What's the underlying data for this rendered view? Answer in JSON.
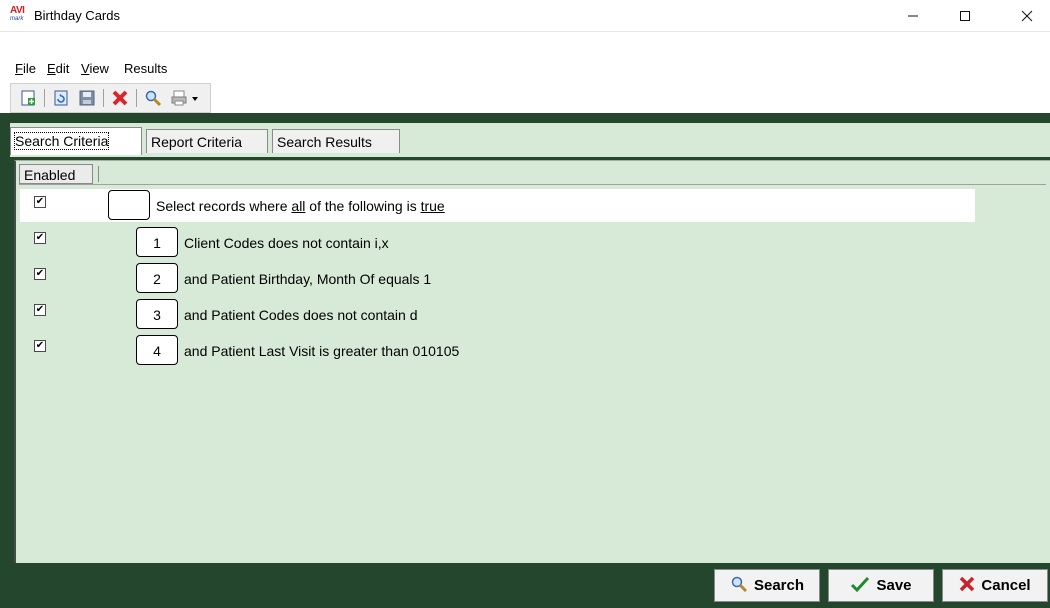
{
  "window": {
    "title": "Birthday Cards",
    "logo_top": "AVI",
    "logo_bottom": "mark",
    "controls": {
      "minimize": "—",
      "maximize": "☐",
      "close": "✕"
    }
  },
  "menu": {
    "items": [
      {
        "u": "F",
        "rest": "ile"
      },
      {
        "u": "E",
        "rest": "dit"
      },
      {
        "u": "V",
        "rest": "iew"
      },
      {
        "u": "",
        "rest": "Results"
      }
    ]
  },
  "toolbar": {
    "icons": [
      "new-record-icon",
      "refresh-icon",
      "save-disk-icon",
      "delete-x-icon",
      "find-magnifier-icon",
      "print-icon",
      "dropdown-arrow-icon"
    ]
  },
  "tabs": [
    "Search Criteria",
    "Report Criteria",
    "Search Results"
  ],
  "grid": {
    "header_enabled": "Enabled",
    "main": {
      "checked_symbol": "✔",
      "prefix": "Select records where ",
      "quantifier": "all",
      "middle": " of the following is ",
      "truth": "true"
    },
    "conditions": [
      {
        "num": "1",
        "text": "Client Codes does not contain i,x",
        "checked": true
      },
      {
        "num": "2",
        "text": "and Patient Birthday, Month Of equals 1",
        "checked": true
      },
      {
        "num": "3",
        "text": "and Patient Codes does not contain d",
        "checked": true
      },
      {
        "num": "4",
        "text": "and Patient Last Visit is greater than 010105",
        "checked": true
      }
    ]
  },
  "buttons": {
    "search": "Search",
    "save": "Save",
    "cancel": "Cancel"
  },
  "colors": {
    "window_green": "#24462c",
    "panel_green": "#d7ead7"
  }
}
